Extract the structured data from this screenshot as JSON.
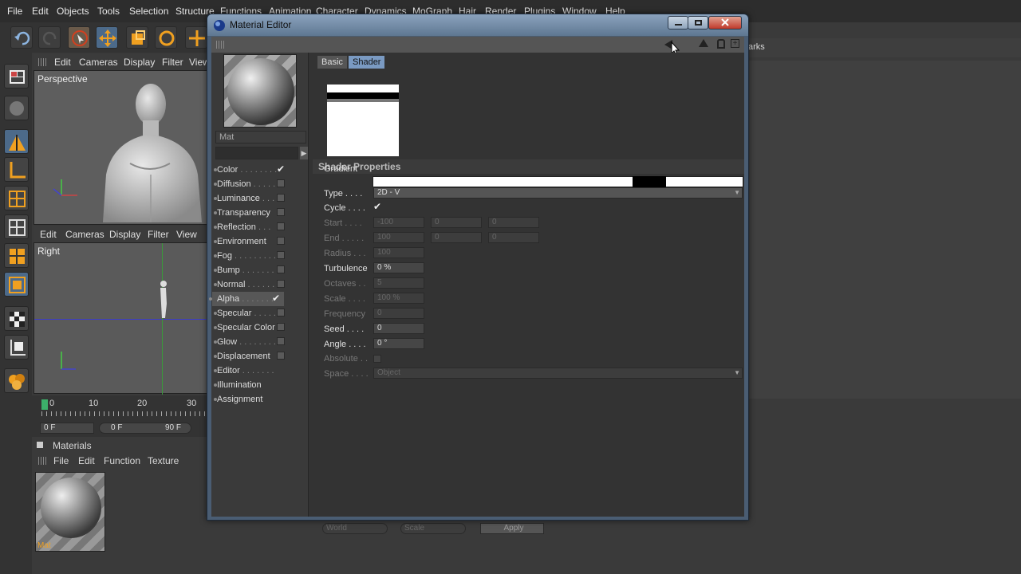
{
  "menu": [
    "File",
    "Edit",
    "Objects",
    "Tools",
    "Selection",
    "Structure",
    "Functions",
    "Animation",
    "Character",
    "Dynamics",
    "MoGraph",
    "Hair",
    "Render",
    "Plugins",
    "Window",
    "Help"
  ],
  "viewport_top": {
    "menu": [
      "Edit",
      "Cameras",
      "Display",
      "Filter",
      "View"
    ],
    "label": "Perspective"
  },
  "viewport_bottom": {
    "menu": [
      "Edit",
      "Cameras",
      "Display",
      "Filter",
      "View"
    ],
    "label": "Right"
  },
  "timeline": {
    "ticks": [
      "0",
      "10",
      "20",
      "30"
    ],
    "current_frame": "0",
    "field_start": "0 F",
    "field_mid": "0 F",
    "field_end": "90 F"
  },
  "materials_panel": {
    "title": "Materials",
    "menu": [
      "File",
      "Edit",
      "Function",
      "Texture"
    ],
    "material_label": "Mat"
  },
  "material_editor": {
    "title": "Material Editor",
    "material_name": "Mat",
    "tabs": [
      "Basic",
      "Shader"
    ],
    "section_title": "Shader Properties",
    "channels": [
      {
        "label": "Color",
        "dots": " . . . . . . . .",
        "checked": true
      },
      {
        "label": "Diffusion",
        "dots": " . . . . .",
        "checked": false
      },
      {
        "label": "Luminance",
        "dots": " . . .",
        "checked": false
      },
      {
        "label": "Transparency",
        "dots": "",
        "checked": false
      },
      {
        "label": "Reflection",
        "dots": " . . .",
        "checked": false
      },
      {
        "label": "Environment",
        "dots": "",
        "checked": false
      },
      {
        "label": "Fog",
        "dots": " . . . . . . . . .",
        "checked": false
      },
      {
        "label": "Bump",
        "dots": " . . . . . . .",
        "checked": false
      },
      {
        "label": "Normal",
        "dots": " . . . . . .",
        "checked": false
      },
      {
        "label": "Alpha",
        "dots": " . . . . . . .",
        "checked": true
      },
      {
        "label": "Specular",
        "dots": " . . . . .",
        "checked": false
      },
      {
        "label": "Specular Color",
        "dots": "",
        "checked": false
      },
      {
        "label": "Glow",
        "dots": " . . . . . . . .",
        "checked": false
      },
      {
        "label": "Displacement",
        "dots": "",
        "checked": false
      },
      {
        "label": "Editor",
        "dots": " . . . . . . .",
        "checked": null
      },
      {
        "label": "Illumination",
        "dots": "",
        "checked": null
      },
      {
        "label": "Assignment",
        "dots": "",
        "checked": null
      }
    ],
    "props": {
      "gradient": "Gradient",
      "type_label": "Type . . . .",
      "type_value": "2D - V",
      "cycle_label": "Cycle . . . .",
      "start_label": "Start . . . .",
      "start_values": [
        "-100",
        "0",
        "0"
      ],
      "end_label": "End . . . . .",
      "end_values": [
        "100",
        "0",
        "0"
      ],
      "radius_label": "Radius . . .",
      "radius_value": "100",
      "turbulence_label": "Turbulence",
      "turbulence_value": "0 %",
      "octaves_label": "Octaves . .",
      "octaves_value": "5",
      "scale_label": "Scale . . . .",
      "scale_value": "100 %",
      "frequency_label": "Frequency",
      "frequency_value": "0",
      "seed_label": "Seed . . . .",
      "seed_value": "0",
      "angle_label": "Angle . . . .",
      "angle_value": "0 °",
      "absolute_label": "Absolute . .",
      "space_label": "Space . . . .",
      "space_value": "Object"
    }
  },
  "right_panel": {
    "tab_partial": "arks"
  },
  "bottom_buttons": {
    "world": "World",
    "scale": "Scale",
    "apply": "Apply"
  }
}
